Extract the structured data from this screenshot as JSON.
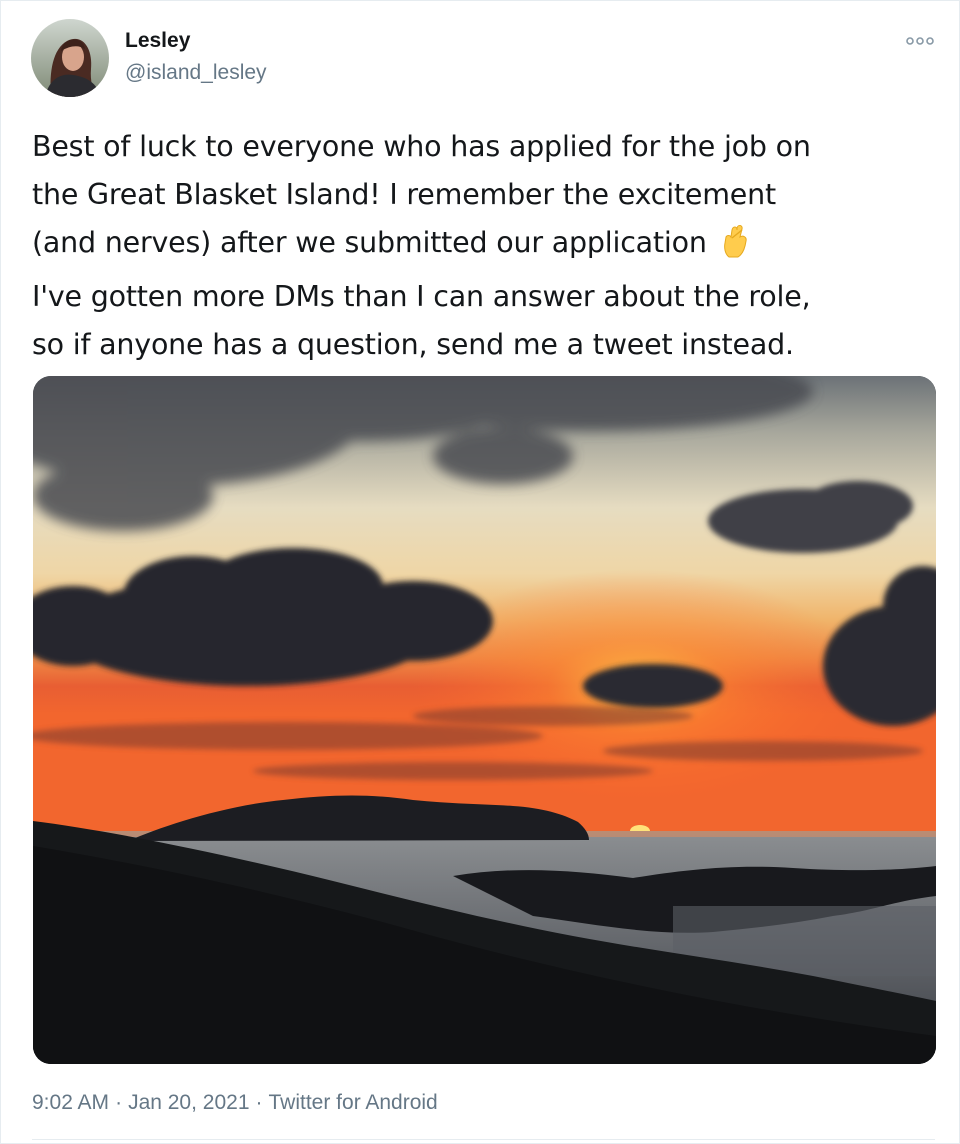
{
  "author": {
    "name": "Lesley",
    "handle": "@island_lesley",
    "avatar_icon": "profile-photo"
  },
  "menu": {
    "more_icon": "more-options-icon"
  },
  "tweet": {
    "lines": [
      "Best of luck to everyone who has applied for the job on",
      "the Great Blasket Island! I remember the excitement",
      "(and nerves) after we submitted our application",
      "I've gotten more DMs than I can answer about the role,",
      "so if anyone has a question, send me a tweet instead."
    ],
    "emoji": "crossed-fingers-icon"
  },
  "media": {
    "subject": "sunset-over-island-photo"
  },
  "meta": {
    "time": "9:02 AM",
    "separator": "·",
    "date": "Jan 20, 2021",
    "source": "Twitter for Android"
  },
  "colors": {
    "text_primary": "#14171a",
    "text_secondary": "#657786",
    "divider": "#e6ecf0"
  }
}
